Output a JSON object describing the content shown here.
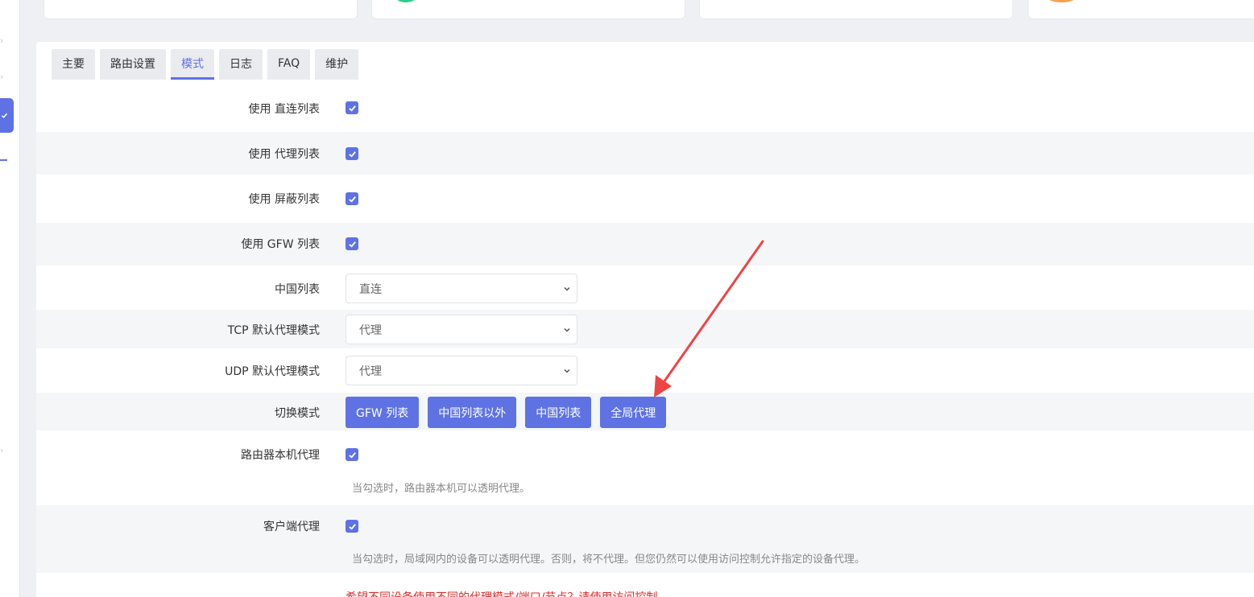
{
  "tabs": [
    {
      "label": "主要"
    },
    {
      "label": "路由设置"
    },
    {
      "label": "模式"
    },
    {
      "label": "日志"
    },
    {
      "label": "FAQ"
    },
    {
      "label": "维护"
    }
  ],
  "active_tab": "模式",
  "form": {
    "use_direct_list": {
      "label": "使用 直连列表",
      "checked": true
    },
    "use_proxy_list": {
      "label": "使用 代理列表",
      "checked": true
    },
    "use_block_list": {
      "label": "使用 屏蔽列表",
      "checked": true
    },
    "use_gfw_list": {
      "label": "使用 GFW 列表",
      "checked": true
    },
    "china_list": {
      "label": "中国列表",
      "value": "直连"
    },
    "tcp_mode": {
      "label": "TCP 默认代理模式",
      "value": "代理"
    },
    "udp_mode": {
      "label": "UDP 默认代理模式",
      "value": "代理"
    },
    "switch_mode": {
      "label": "切换模式",
      "buttons": [
        "GFW 列表",
        "中国列表以外",
        "中国列表",
        "全局代理"
      ]
    },
    "router_proxy": {
      "label": "路由器本机代理",
      "checked": true,
      "help": "当勾选时，路由器本机可以透明代理。"
    },
    "client_proxy": {
      "label": "客户端代理",
      "checked": true,
      "help": "当勾选时，局域网内的设备可以透明代理。否则，将不代理。但您仍然可以使用访问控制允许指定的设备代理。"
    },
    "warning": "希望不同设备使用不同的代理模式/端口/节点？请使用访问控制"
  },
  "colors": {
    "accent": "#5e72e4",
    "annotation_arrow": "#ee4444",
    "warning_text": "#e02b2b"
  }
}
